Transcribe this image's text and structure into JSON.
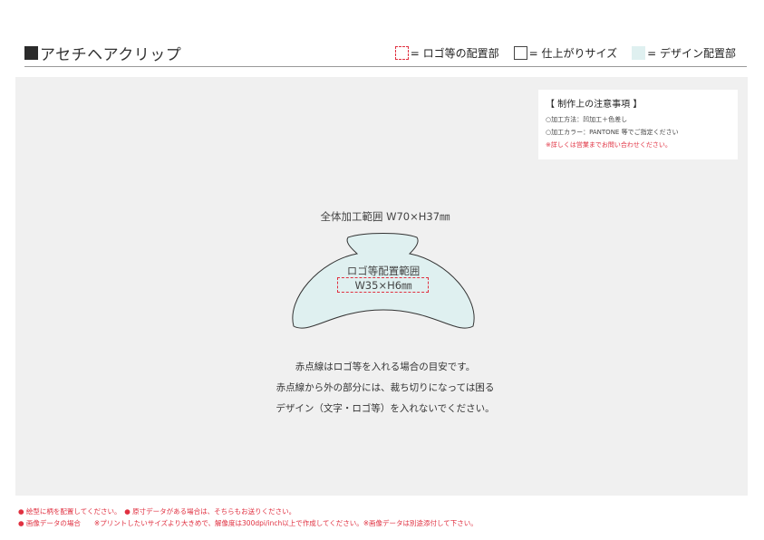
{
  "header": {
    "title": "アセチヘアクリップ",
    "legend": {
      "logo_area": "= ロゴ等の配置部",
      "finish_size": "= 仕上がりサイズ",
      "design_area": "= デザイン配置部"
    }
  },
  "notes": {
    "title": "【 制作上の注意事項 】",
    "lines": [
      "○加工方法：凹加工＋色差し",
      "○加工カラー：PANTONE 等でご指定ください"
    ],
    "warning": "※詳しくは営業までお問い合わせください。"
  },
  "product": {
    "full_area": "全体加工範囲 W70×H37㎜",
    "logo_area_label": "ロゴ等配置範囲",
    "logo_area_size": "W35×H6㎜"
  },
  "description": [
    "赤点線はロゴ等を入れる場合の目安です。",
    "赤点線から外の部分には、裁ち切りになっては困る",
    "デザイン（文字・ロゴ等）を入れないでください。"
  ],
  "footer": [
    "● 絵型に柄を配置してください。　● 原寸データがある場合は、そちらもお送りください。",
    "● 画像データの場合　　※プリントしたいサイズより大きめで、解像度は300dpi/inch以上で作成してください。※画像データは別途添付して下さい。"
  ],
  "colors": {
    "accent_red": "#e03040",
    "design_fill": "#dff0f0",
    "canvas_bg": "#f0f0f0"
  }
}
